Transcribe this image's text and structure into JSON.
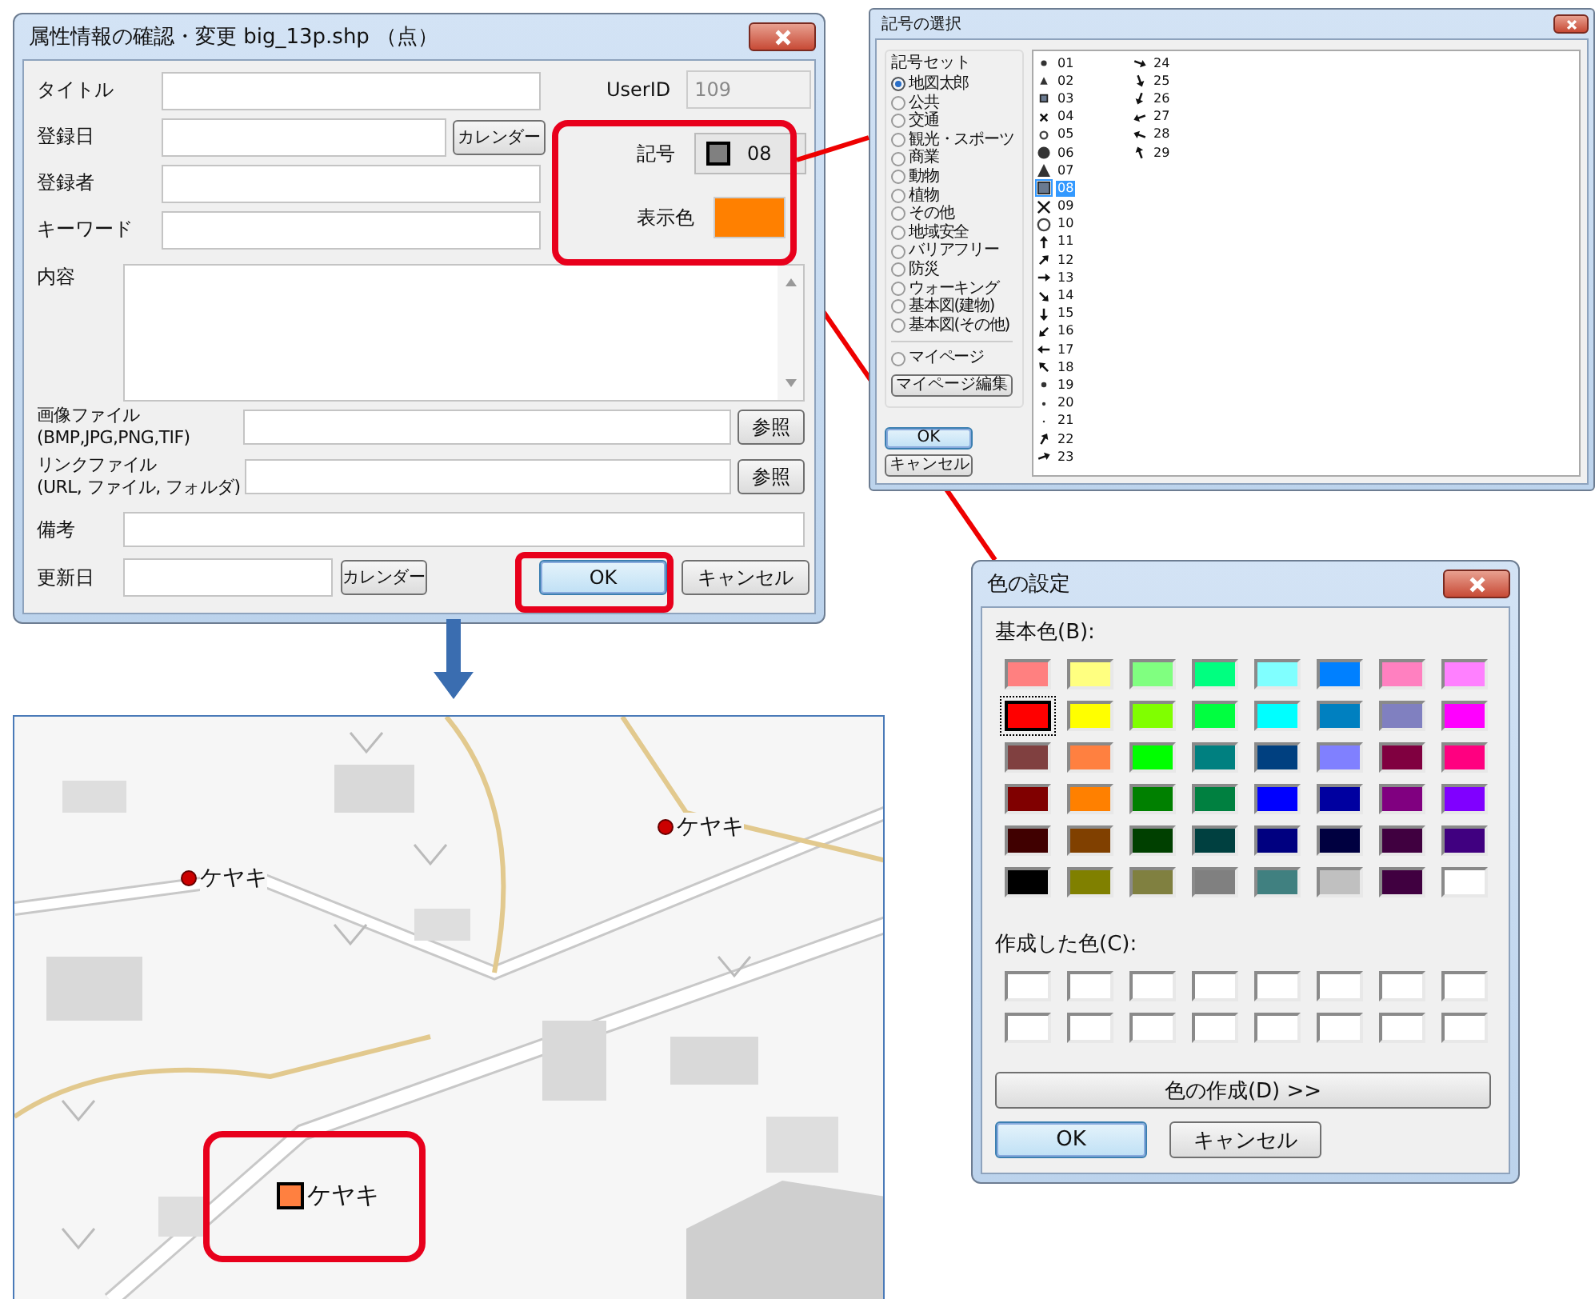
{
  "attribute_dialog": {
    "title": "属性情報の確認・変更 big_13p.shp （点）",
    "title_field": {
      "label": "タイトル"
    },
    "registered_date": {
      "label": "登録日",
      "button": "カレンダー"
    },
    "registrant": {
      "label": "登録者"
    },
    "keyword": {
      "label": "キーワード"
    },
    "user_id": {
      "label": "UserID",
      "value": "109",
      "disabled": true
    },
    "symbol": {
      "label": "記号",
      "value": "08"
    },
    "display_color": {
      "label": "表示色",
      "color": "#ff8000"
    },
    "content": {
      "label": "内容"
    },
    "image_file": {
      "label": "画像ファイル\n(BMP,JPG,PNG,TIF)",
      "button": "参照"
    },
    "link_file": {
      "label": "リンクファイル\n(URL, ファイル, フォルダ)",
      "button": "参照"
    },
    "remarks": {
      "label": "備考"
    },
    "updated_date": {
      "label": "更新日",
      "button": "カレンダー"
    },
    "buttons": [
      "OK",
      "キャンセル"
    ]
  },
  "symbol_dialog": {
    "title": "記号の選択",
    "group_label": "記号セット",
    "symbol_sets": [
      {
        "label": "地図太郎",
        "selected": true
      },
      {
        "label": "公共",
        "selected": false
      },
      {
        "label": "交通",
        "selected": false
      },
      {
        "label": "観光・スポーツ",
        "selected": false
      },
      {
        "label": "商業",
        "selected": false
      },
      {
        "label": "動物",
        "selected": false
      },
      {
        "label": "植物",
        "selected": false
      },
      {
        "label": "その他",
        "selected": false
      },
      {
        "label": "地域安全",
        "selected": false
      },
      {
        "label": "バリアフリー",
        "selected": false
      },
      {
        "label": "防災",
        "selected": false
      },
      {
        "label": "ウォーキング",
        "selected": false
      },
      {
        "label": "基本図(建物)",
        "selected": false
      },
      {
        "label": "基本図(その他)",
        "selected": false
      }
    ],
    "my_page": {
      "label": "マイページ",
      "selected": false
    },
    "edit_button": "マイページ編集",
    "buttons": [
      "OK",
      "キャンセル"
    ],
    "symbols": [
      {
        "number": "01",
        "selected": false
      },
      {
        "number": "02",
        "selected": false
      },
      {
        "number": "03",
        "selected": false
      },
      {
        "number": "04",
        "selected": false
      },
      {
        "number": "05",
        "selected": false
      },
      {
        "number": "06",
        "selected": false
      },
      {
        "number": "07",
        "selected": false
      },
      {
        "number": "08",
        "selected": true
      },
      {
        "number": "09",
        "selected": false
      },
      {
        "number": "10",
        "selected": false
      },
      {
        "number": "11",
        "selected": false
      },
      {
        "number": "12",
        "selected": false
      },
      {
        "number": "13",
        "selected": false
      },
      {
        "number": "14",
        "selected": false
      },
      {
        "number": "15",
        "selected": false
      },
      {
        "number": "16",
        "selected": false
      },
      {
        "number": "17",
        "selected": false
      },
      {
        "number": "18",
        "selected": false
      },
      {
        "number": "19",
        "selected": false
      },
      {
        "number": "20",
        "selected": false
      },
      {
        "number": "21",
        "selected": false
      },
      {
        "number": "22",
        "selected": false
      },
      {
        "number": "23",
        "selected": false
      },
      {
        "number": "24",
        "selected": false
      },
      {
        "number": "25",
        "selected": false
      },
      {
        "number": "26",
        "selected": false
      },
      {
        "number": "27",
        "selected": false
      },
      {
        "number": "28",
        "selected": false
      },
      {
        "number": "29",
        "selected": false
      }
    ]
  },
  "color_dialog": {
    "title": "色の設定",
    "basic_label": "基本色(B):",
    "basic_colors": [
      {
        "color": "#ff8080",
        "selected": false
      },
      {
        "color": "#ffff80",
        "selected": false
      },
      {
        "color": "#80ff80",
        "selected": false
      },
      {
        "color": "#00ff80",
        "selected": false
      },
      {
        "color": "#80ffff",
        "selected": false
      },
      {
        "color": "#0080ff",
        "selected": false
      },
      {
        "color": "#ff80c0",
        "selected": false
      },
      {
        "color": "#ff80ff",
        "selected": false
      },
      {
        "color": "#ff0000",
        "selected": true
      },
      {
        "color": "#ffff00",
        "selected": false
      },
      {
        "color": "#80ff00",
        "selected": false
      },
      {
        "color": "#00ff40",
        "selected": false
      },
      {
        "color": "#00ffff",
        "selected": false
      },
      {
        "color": "#0080c0",
        "selected": false
      },
      {
        "color": "#8080c0",
        "selected": false
      },
      {
        "color": "#ff00ff",
        "selected": false
      },
      {
        "color": "#804040",
        "selected": false
      },
      {
        "color": "#ff8040",
        "selected": false
      },
      {
        "color": "#00ff00",
        "selected": false
      },
      {
        "color": "#008080",
        "selected": false
      },
      {
        "color": "#004080",
        "selected": false
      },
      {
        "color": "#8080ff",
        "selected": false
      },
      {
        "color": "#800040",
        "selected": false
      },
      {
        "color": "#ff0080",
        "selected": false
      },
      {
        "color": "#800000",
        "selected": false
      },
      {
        "color": "#ff8000",
        "selected": false
      },
      {
        "color": "#008000",
        "selected": false
      },
      {
        "color": "#008040",
        "selected": false
      },
      {
        "color": "#0000ff",
        "selected": false
      },
      {
        "color": "#0000a0",
        "selected": false
      },
      {
        "color": "#800080",
        "selected": false
      },
      {
        "color": "#8000ff",
        "selected": false
      },
      {
        "color": "#400000",
        "selected": false
      },
      {
        "color": "#804000",
        "selected": false
      },
      {
        "color": "#004000",
        "selected": false
      },
      {
        "color": "#004040",
        "selected": false
      },
      {
        "color": "#000080",
        "selected": false
      },
      {
        "color": "#000040",
        "selected": false
      },
      {
        "color": "#400040",
        "selected": false
      },
      {
        "color": "#400080",
        "selected": false
      },
      {
        "color": "#000000",
        "selected": false
      },
      {
        "color": "#808000",
        "selected": false
      },
      {
        "color": "#808040",
        "selected": false
      },
      {
        "color": "#808080",
        "selected": false
      },
      {
        "color": "#408080",
        "selected": false
      },
      {
        "color": "#c0c0c0",
        "selected": false
      },
      {
        "color": "#400040",
        "selected": false
      },
      {
        "color": "#ffffff",
        "selected": false
      }
    ],
    "custom_label": "作成した色(C):",
    "custom_colors": [
      {
        "color": "#ffffff"
      },
      {
        "color": "#ffffff"
      },
      {
        "color": "#ffffff"
      },
      {
        "color": "#ffffff"
      },
      {
        "color": "#ffffff"
      },
      {
        "color": "#ffffff"
      },
      {
        "color": "#ffffff"
      },
      {
        "color": "#ffffff"
      },
      {
        "color": "#ffffff"
      },
      {
        "color": "#ffffff"
      },
      {
        "color": "#ffffff"
      },
      {
        "color": "#ffffff"
      },
      {
        "color": "#ffffff"
      },
      {
        "color": "#ffffff"
      },
      {
        "color": "#ffffff"
      },
      {
        "color": "#ffffff"
      }
    ],
    "define_button": "色の作成(D) >>",
    "buttons": [
      "OK",
      "キャンセル"
    ]
  },
  "map": {
    "kind": "picture",
    "markers": [
      {
        "label": "ケヤキ",
        "kind": "dot",
        "color": "#cc0000"
      },
      {
        "label": "ケヤキ",
        "kind": "dot",
        "color": "#cc0000"
      },
      {
        "label": "ケヤキ",
        "kind": "square",
        "color": "#ff8040"
      }
    ]
  }
}
